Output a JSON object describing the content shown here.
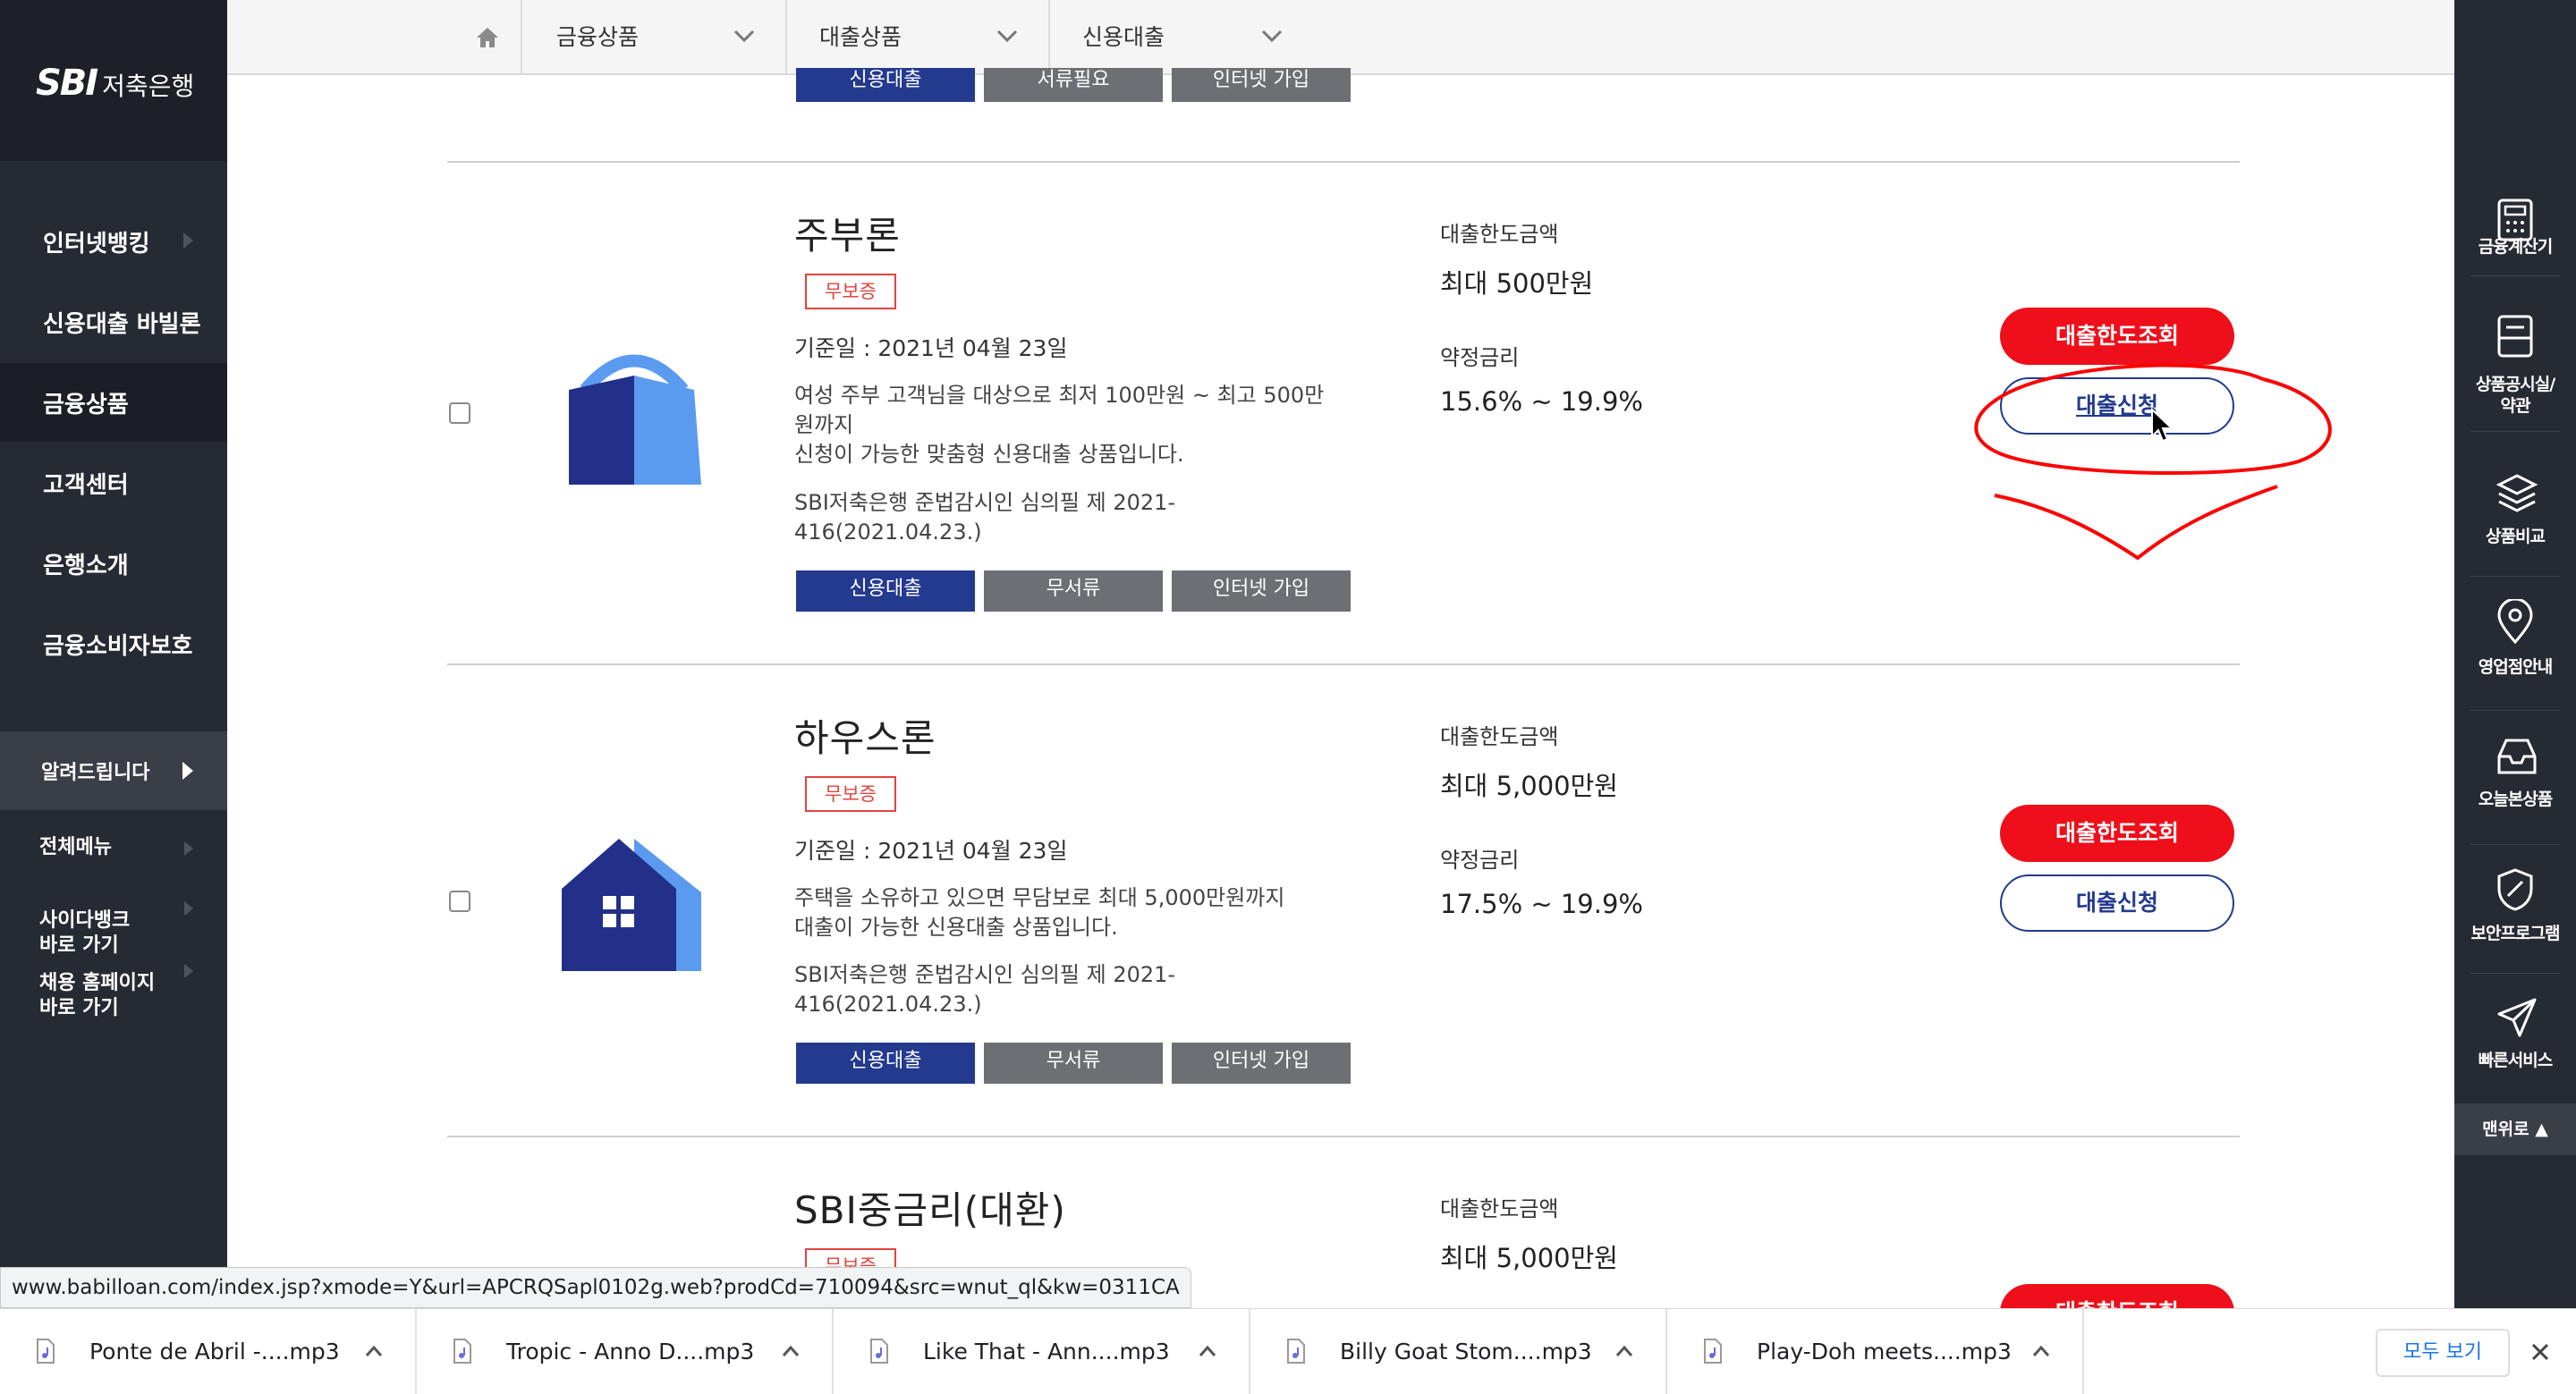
{
  "brand": {
    "sbi": "SBI",
    "bank": "저축은행"
  },
  "left_nav": {
    "items": [
      {
        "label": "인터넷뱅킹"
      },
      {
        "label": "신용대출 바빌론"
      },
      {
        "label": "금융상품"
      },
      {
        "label": "고객센터"
      },
      {
        "label": "은행소개"
      },
      {
        "label": "금융소비자보호"
      }
    ],
    "notice": "알려드립니다",
    "sub_items": [
      {
        "label": "전체메뉴"
      },
      {
        "label": "사이다뱅크\n바로 가기"
      },
      {
        "label": "채용 홈페이지\n바로 가기"
      }
    ]
  },
  "breadcrumb": {
    "home_icon": "home-icon",
    "level1": "금융상품",
    "level2": "대출상품",
    "level3": "신용대출"
  },
  "right_nav": {
    "items": [
      {
        "label": "금융계산기",
        "icon": "calculator-icon"
      },
      {
        "label": "상품공시실/\n약관",
        "icon": "document-icon"
      },
      {
        "label": "상품비교",
        "icon": "layers-icon"
      },
      {
        "label": "영업점안내",
        "icon": "location-pin-icon"
      },
      {
        "label": "오늘본상품",
        "icon": "inbox-icon"
      },
      {
        "label": "보안프로그램",
        "icon": "shield-icon"
      },
      {
        "label": "빠른서비스",
        "icon": "paper-plane-icon"
      }
    ],
    "top_button": "맨위로 ▲"
  },
  "partial_top_tags": [
    "신용대출",
    "서류필요",
    "인터넷 가입"
  ],
  "products": [
    {
      "title": "주부론",
      "badge": "무보증",
      "date": "기준일 : 2021년 04월 23일",
      "desc": "여성 주부 고객님을 대상으로 최저 100만원 ~ 최고 500만\n원까지\n신청이 가능한 맞춤형 신용대출 상품입니다.",
      "compliance": "SBI저축은행 준법감시인 심의필 제 2021-\n416(2021.04.23.)",
      "tags": [
        "신용대출",
        "무서류",
        "인터넷 가입"
      ],
      "limit_label": "대출한도금액",
      "limit_value": "최대 500만원",
      "rate_label": "약정금리",
      "rate_value": "15.6% ~ 19.9%",
      "btn_limit": "대출한도조회",
      "btn_apply": "대출신청",
      "icon": "shopping-bag-icon"
    },
    {
      "title": "하우스론",
      "badge": "무보증",
      "date": "기준일 : 2021년 04월 23일",
      "desc": "주택을 소유하고 있으면 무담보로 최대 5,000만원까지\n대출이 가능한 신용대출 상품입니다.",
      "compliance": "SBI저축은행 준법감시인 심의필 제 2021-\n416(2021.04.23.)",
      "tags": [
        "신용대출",
        "무서류",
        "인터넷 가입"
      ],
      "limit_label": "대출한도금액",
      "limit_value": "최대 5,000만원",
      "rate_label": "약정금리",
      "rate_value": "17.5% ~ 19.9%",
      "btn_limit": "대출한도조회",
      "btn_apply": "대출신청",
      "icon": "house-icon"
    },
    {
      "title": "SBI중금리(대환)",
      "badge": "무보증",
      "limit_label": "대출한도금액",
      "limit_value": "최대 5,000만원",
      "btn_limit": "대출한도조회"
    }
  ],
  "status_url": "www.babilloan.com/index.jsp?xmode=Y&url=APCRQSapl0102g.web?prodCd=710094&src=wnut_ql&kw=0311CA",
  "downloads": {
    "files": [
      {
        "name": "Ponte de Abril -....mp3"
      },
      {
        "name": "Tropic - Anno D....mp3"
      },
      {
        "name": "Like That - Ann....mp3"
      },
      {
        "name": "Billy Goat Stom....mp3"
      },
      {
        "name": "Play-Doh meets....mp3"
      }
    ],
    "show_all": "모두 보기"
  },
  "colors": {
    "accent_blue": "#233a8f",
    "light_blue": "#5b9bef",
    "red": "#ee0f1a",
    "sidebar": "#262a33",
    "annotation": "#ff0000"
  }
}
